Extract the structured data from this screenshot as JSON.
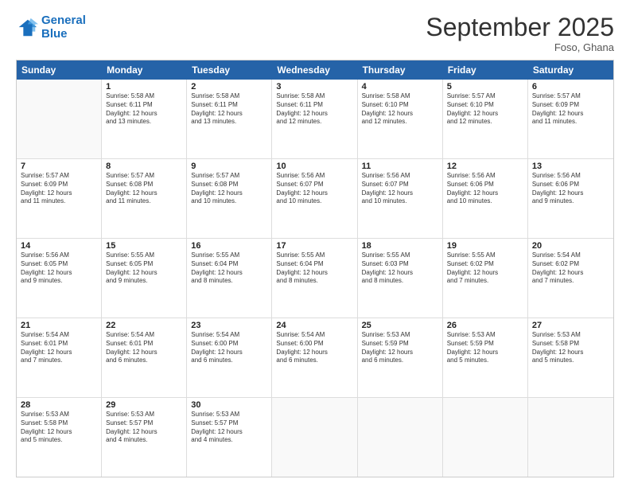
{
  "header": {
    "logo_line1": "General",
    "logo_line2": "Blue",
    "month_title": "September 2025",
    "location": "Foso, Ghana"
  },
  "days_of_week": [
    "Sunday",
    "Monday",
    "Tuesday",
    "Wednesday",
    "Thursday",
    "Friday",
    "Saturday"
  ],
  "weeks": [
    [
      {
        "day": "",
        "info": ""
      },
      {
        "day": "1",
        "info": "Sunrise: 5:58 AM\nSunset: 6:11 PM\nDaylight: 12 hours\nand 13 minutes."
      },
      {
        "day": "2",
        "info": "Sunrise: 5:58 AM\nSunset: 6:11 PM\nDaylight: 12 hours\nand 13 minutes."
      },
      {
        "day": "3",
        "info": "Sunrise: 5:58 AM\nSunset: 6:11 PM\nDaylight: 12 hours\nand 12 minutes."
      },
      {
        "day": "4",
        "info": "Sunrise: 5:58 AM\nSunset: 6:10 PM\nDaylight: 12 hours\nand 12 minutes."
      },
      {
        "day": "5",
        "info": "Sunrise: 5:57 AM\nSunset: 6:10 PM\nDaylight: 12 hours\nand 12 minutes."
      },
      {
        "day": "6",
        "info": "Sunrise: 5:57 AM\nSunset: 6:09 PM\nDaylight: 12 hours\nand 11 minutes."
      }
    ],
    [
      {
        "day": "7",
        "info": "Sunrise: 5:57 AM\nSunset: 6:09 PM\nDaylight: 12 hours\nand 11 minutes."
      },
      {
        "day": "8",
        "info": "Sunrise: 5:57 AM\nSunset: 6:08 PM\nDaylight: 12 hours\nand 11 minutes."
      },
      {
        "day": "9",
        "info": "Sunrise: 5:57 AM\nSunset: 6:08 PM\nDaylight: 12 hours\nand 10 minutes."
      },
      {
        "day": "10",
        "info": "Sunrise: 5:56 AM\nSunset: 6:07 PM\nDaylight: 12 hours\nand 10 minutes."
      },
      {
        "day": "11",
        "info": "Sunrise: 5:56 AM\nSunset: 6:07 PM\nDaylight: 12 hours\nand 10 minutes."
      },
      {
        "day": "12",
        "info": "Sunrise: 5:56 AM\nSunset: 6:06 PM\nDaylight: 12 hours\nand 10 minutes."
      },
      {
        "day": "13",
        "info": "Sunrise: 5:56 AM\nSunset: 6:06 PM\nDaylight: 12 hours\nand 9 minutes."
      }
    ],
    [
      {
        "day": "14",
        "info": "Sunrise: 5:56 AM\nSunset: 6:05 PM\nDaylight: 12 hours\nand 9 minutes."
      },
      {
        "day": "15",
        "info": "Sunrise: 5:55 AM\nSunset: 6:05 PM\nDaylight: 12 hours\nand 9 minutes."
      },
      {
        "day": "16",
        "info": "Sunrise: 5:55 AM\nSunset: 6:04 PM\nDaylight: 12 hours\nand 8 minutes."
      },
      {
        "day": "17",
        "info": "Sunrise: 5:55 AM\nSunset: 6:04 PM\nDaylight: 12 hours\nand 8 minutes."
      },
      {
        "day": "18",
        "info": "Sunrise: 5:55 AM\nSunset: 6:03 PM\nDaylight: 12 hours\nand 8 minutes."
      },
      {
        "day": "19",
        "info": "Sunrise: 5:55 AM\nSunset: 6:02 PM\nDaylight: 12 hours\nand 7 minutes."
      },
      {
        "day": "20",
        "info": "Sunrise: 5:54 AM\nSunset: 6:02 PM\nDaylight: 12 hours\nand 7 minutes."
      }
    ],
    [
      {
        "day": "21",
        "info": "Sunrise: 5:54 AM\nSunset: 6:01 PM\nDaylight: 12 hours\nand 7 minutes."
      },
      {
        "day": "22",
        "info": "Sunrise: 5:54 AM\nSunset: 6:01 PM\nDaylight: 12 hours\nand 6 minutes."
      },
      {
        "day": "23",
        "info": "Sunrise: 5:54 AM\nSunset: 6:00 PM\nDaylight: 12 hours\nand 6 minutes."
      },
      {
        "day": "24",
        "info": "Sunrise: 5:54 AM\nSunset: 6:00 PM\nDaylight: 12 hours\nand 6 minutes."
      },
      {
        "day": "25",
        "info": "Sunrise: 5:53 AM\nSunset: 5:59 PM\nDaylight: 12 hours\nand 6 minutes."
      },
      {
        "day": "26",
        "info": "Sunrise: 5:53 AM\nSunset: 5:59 PM\nDaylight: 12 hours\nand 5 minutes."
      },
      {
        "day": "27",
        "info": "Sunrise: 5:53 AM\nSunset: 5:58 PM\nDaylight: 12 hours\nand 5 minutes."
      }
    ],
    [
      {
        "day": "28",
        "info": "Sunrise: 5:53 AM\nSunset: 5:58 PM\nDaylight: 12 hours\nand 5 minutes."
      },
      {
        "day": "29",
        "info": "Sunrise: 5:53 AM\nSunset: 5:57 PM\nDaylight: 12 hours\nand 4 minutes."
      },
      {
        "day": "30",
        "info": "Sunrise: 5:53 AM\nSunset: 5:57 PM\nDaylight: 12 hours\nand 4 minutes."
      },
      {
        "day": "",
        "info": ""
      },
      {
        "day": "",
        "info": ""
      },
      {
        "day": "",
        "info": ""
      },
      {
        "day": "",
        "info": ""
      }
    ]
  ]
}
